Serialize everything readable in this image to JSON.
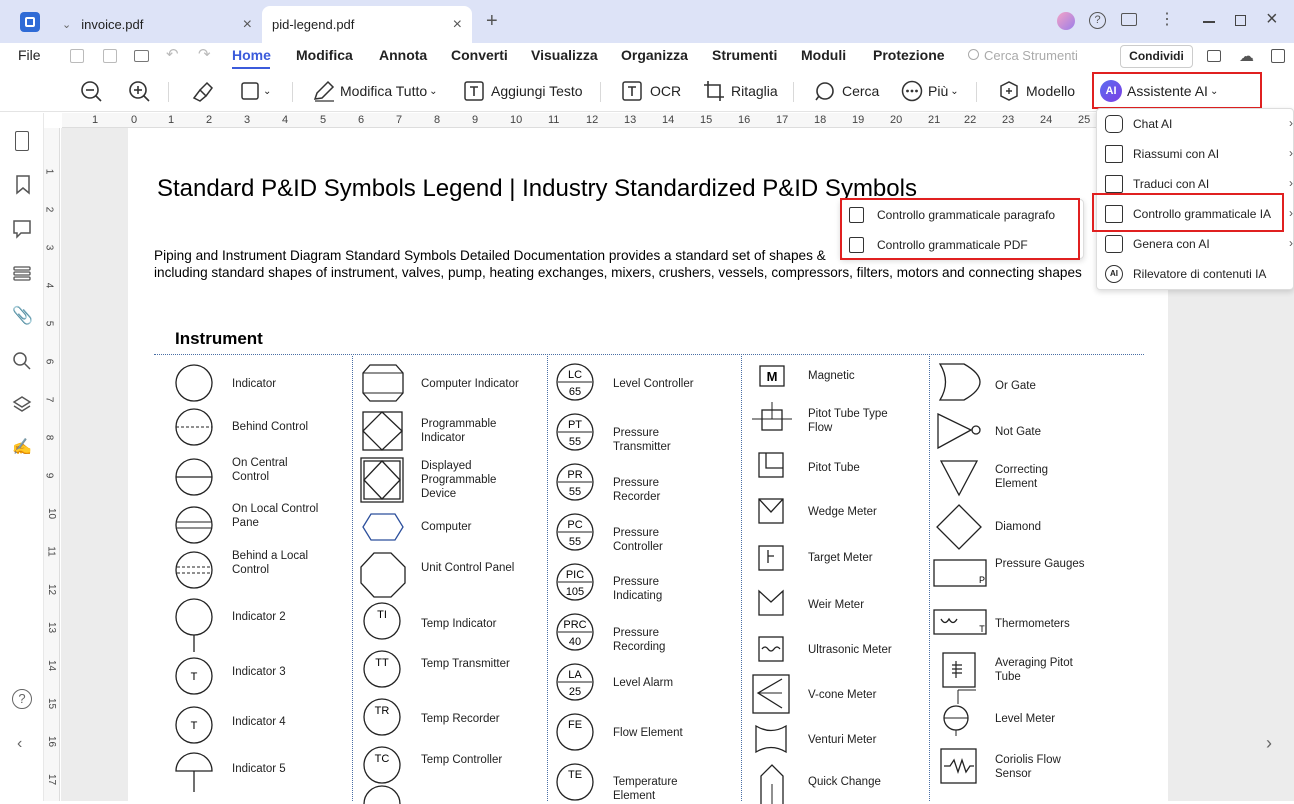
{
  "tabs": [
    {
      "label": "invoice.pdf",
      "active": false
    },
    {
      "label": "pid-legend.pdf",
      "active": true
    }
  ],
  "menubar": {
    "file": "File",
    "items": [
      "Home",
      "Modifica",
      "Annota",
      "Converti",
      "Visualizza",
      "Organizza",
      "Strumenti",
      "Moduli",
      "Protezione"
    ],
    "search_placeholder": "Cerca Strumenti",
    "share": "Condividi"
  },
  "toolbar": {
    "edit_all": "Modifica Tutto",
    "add_text": "Aggiungi Testo",
    "ocr": "OCR",
    "crop": "Ritaglia",
    "search": "Cerca",
    "more": "Più",
    "template": "Modello",
    "ai_assistant": "Assistente AI",
    "ai_badge": "AI"
  },
  "ruler_h": [
    "1",
    "0",
    "1",
    "2",
    "3",
    "4",
    "5",
    "6",
    "7",
    "8",
    "9",
    "10",
    "11",
    "12",
    "13",
    "14",
    "15",
    "16",
    "17",
    "18",
    "19",
    "20",
    "21",
    "22",
    "23",
    "24",
    "25"
  ],
  "ruler_v": [
    "1",
    "2",
    "3",
    "4",
    "5",
    "6",
    "7",
    "8",
    "9",
    "10",
    "11",
    "12",
    "13",
    "14",
    "15",
    "16",
    "17"
  ],
  "document": {
    "title": "Standard P&ID Symbols Legend | Industry Standardized P&ID Symbols",
    "intro_line1": "Piping and Instrument Diagram Standard Symbols Detailed Documentation provides a standard set of shapes &",
    "intro_line2": "including standard shapes of instrument, valves, pump, heating exchanges, mixers, crushers, vessels, compressors, filters, motors and connecting shapes",
    "section": "Instrument",
    "col1": [
      "Indicator",
      "Behind Control",
      "On Central Control",
      "On Local Control Pane",
      "Behind a Local Control",
      "Indicator 2",
      "Indicator 3",
      "Indicator 4",
      "Indicator 5"
    ],
    "col1_letters": [
      "T",
      "T"
    ],
    "col2": [
      "Computer Indicator",
      "Programmable Indicator",
      "Displayed Programmable Device",
      "Computer",
      "Unit Control Panel",
      "Temp Indicator",
      "Temp Transmitter",
      "Temp Recorder",
      "Temp Controller"
    ],
    "col2_codes": [
      "TI",
      "TT",
      "TR",
      "TC"
    ],
    "col3": [
      "Level Controller",
      "Pressure Transmitter",
      "Pressure Recorder",
      "Pressure Controller",
      "Pressure Indicating",
      "Pressure Recording",
      "Level Alarm",
      "Flow Element",
      "Temperature Element"
    ],
    "col3_codes": [
      [
        "LC",
        "65"
      ],
      [
        "PT",
        "55"
      ],
      [
        "PR",
        "55"
      ],
      [
        "PC",
        "55"
      ],
      [
        "PIC",
        "105"
      ],
      [
        "PRC",
        "40"
      ],
      [
        "LA",
        "25"
      ],
      [
        "FE",
        ""
      ],
      [
        "TE",
        ""
      ]
    ],
    "col4": [
      "Magnetic",
      "Pitot Tube Type Flow",
      "Pitot Tube",
      "Wedge Meter",
      "Target Meter",
      "Weir Meter",
      "Ultrasonic Meter",
      "V-cone Meter",
      "Venturi Meter",
      "Quick Change"
    ],
    "col4_magnetic_letter": "M",
    "col5": [
      "Or Gate",
      "Not Gate",
      "Correcting Element",
      "Diamond",
      "Pressure Gauges",
      "Thermometers",
      "Averaging Pitot Tube",
      "Level Meter",
      "Coriolis Flow Sensor"
    ],
    "col5_letters": {
      "pressure": "P",
      "thermo": "T"
    }
  },
  "ai_menu": [
    "Chat AI",
    "Riassumi con AI",
    "Traduci con AI",
    "Controllo grammaticale IA",
    "Genera con AI",
    "Rilevatore di contenuti IA"
  ],
  "ai_submenu": [
    "Controllo grammaticale paragrafo",
    "Controllo grammaticale PDF"
  ],
  "colors": {
    "accent": "#3b5bdb",
    "highlight": "#e02020",
    "titlebar": "#dde3f7"
  }
}
